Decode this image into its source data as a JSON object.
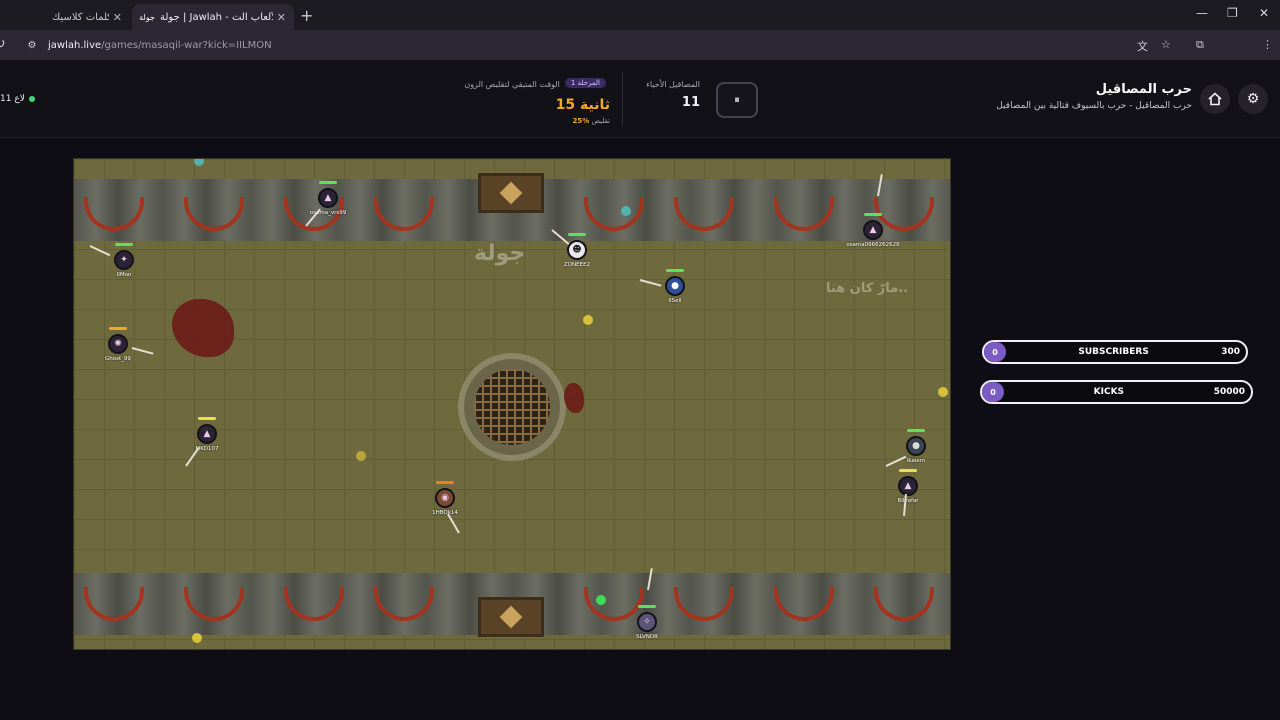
{
  "browser": {
    "tabs": [
      {
        "title": "كلمات كلاسيك",
        "active": false
      },
      {
        "title": "جولة | Jawlah - منصة الألعاب الت",
        "favicon": "جولة",
        "active": true
      }
    ],
    "url_host": "jawlah.live",
    "url_path": "/games/masaqil-war?kick=IILMON"
  },
  "header": {
    "online_count": "11 لاع",
    "time_label": "الوقت المتبقي لتقليص الزون",
    "stage_badge": "المرحلة 1",
    "seconds": "15 ثانية",
    "shrink_pct": "25%",
    "shrink_label": "تقليص",
    "alive_label": "المصاقيل الأحياء",
    "alive_count": "11",
    "pause_icon": "⏸",
    "game_title": "حرب المصاقيل",
    "game_subtitle": "حرب المصاقيل - حرب بالسيوف قتالية بين المصاقيل"
  },
  "arena": {
    "graffiti_1": "جولة",
    "graffiti_2": "مارّ كان هنا..",
    "players": [
      {
        "name": "osama_vrs99",
        "hp_color": "#5fe05f"
      },
      {
        "name": "IIMon",
        "hp_color": "#5fe05f"
      },
      {
        "name": "ZONEEE2",
        "hp_color": "#5fe05f"
      },
      {
        "name": "IISeil",
        "hp_color": "#5fe05f"
      },
      {
        "name": "osama0966262626",
        "hp_color": "#5fe05f"
      },
      {
        "name": "Ghost_99",
        "hp_color": "#f5a623"
      },
      {
        "name": "MKD107",
        "hp_color": "#e8e04a"
      },
      {
        "name": "1HBOk14",
        "hp_color": "#f57c23"
      },
      {
        "name": "Ikaiem",
        "hp_color": "#5fe05f"
      },
      {
        "name": "Bilyafar",
        "hp_color": "#e8e04a"
      },
      {
        "name": "SLVNDR",
        "hp_color": "#5fe05f"
      }
    ]
  },
  "goals": [
    {
      "label": "SUBSCRIBERS",
      "current": "0",
      "target": "300"
    },
    {
      "label": "KICKS",
      "current": "0",
      "target": "50000"
    }
  ],
  "colors": {
    "accent": "#7b5bc4",
    "timer": "#f5a623",
    "online": "#3ddc7a"
  }
}
